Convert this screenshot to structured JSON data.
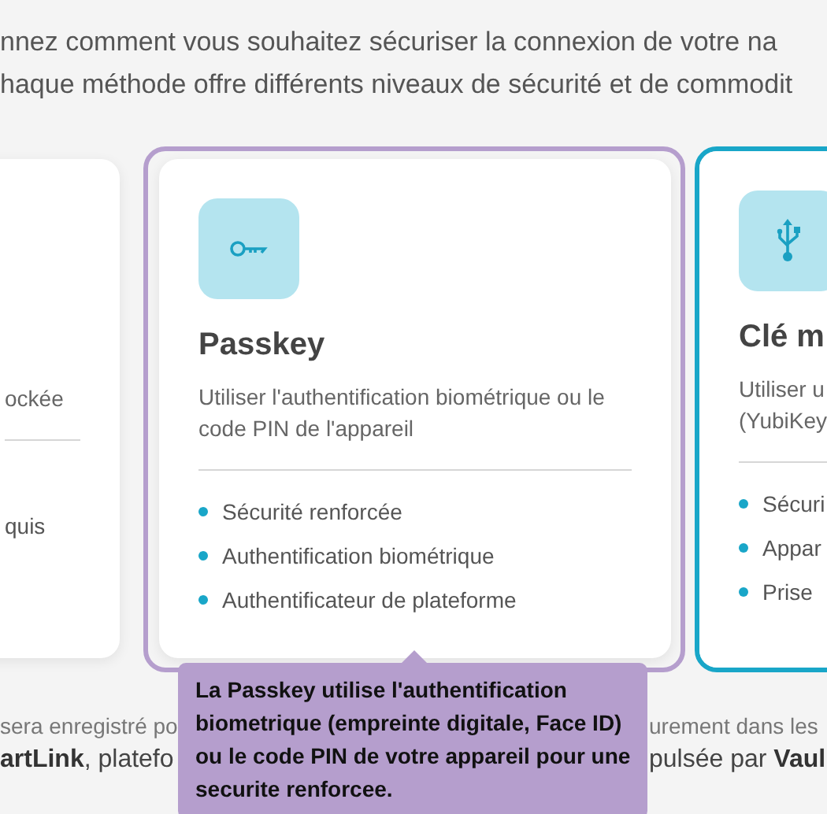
{
  "intro": [
    "nnez comment vous souhaitez sécuriser la connexion de votre na",
    "haque méthode offre différents niveaux de sécurité et de commodit"
  ],
  "methods": [
    {
      "kind": "partial",
      "selected": false,
      "focused": false,
      "description": [
        "ockée"
      ],
      "features": [
        "quis"
      ]
    },
    {
      "kind": "full",
      "selected": true,
      "focused": false,
      "title": "Passkey",
      "description": [
        "Utiliser l'authentification biométrique ou le",
        "code PIN de l'appareil"
      ],
      "features": [
        "Sécurité renforcée",
        "Authentification biométrique",
        "Authentificateur de plateforme"
      ]
    },
    {
      "kind": "full",
      "selected": false,
      "focused": true,
      "title": "Clé m",
      "description": [
        "Utiliser u",
        "(YubiKey"
      ],
      "features": [
        "Sécuri",
        "Appar",
        "Prise"
      ]
    }
  ],
  "tooltip": "La Passkey utilise l'authentification biometrique (empreinte digitale, Face ID) ou le code PIN de votre appareil pour une securite renforcee.",
  "footer": [
    {
      "kind": "note",
      "left": "sera enregistré po",
      "right": "urement dans les"
    },
    {
      "kind": "brand",
      "left": "**artLink**, platefo",
      "right": "pulsée par **Vaul**"
    }
  ]
}
